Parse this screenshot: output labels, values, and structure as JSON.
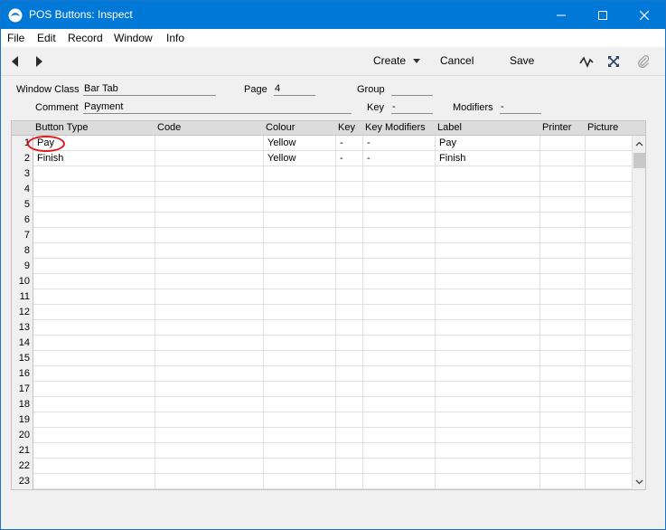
{
  "window": {
    "title": "POS Buttons: Inspect",
    "accent": "#0078d7"
  },
  "menu": [
    "File",
    "Edit",
    "Record",
    "Window",
    "Info"
  ],
  "toolbar": {
    "create_label": "Create",
    "cancel_label": "Cancel",
    "save_label": "Save"
  },
  "header": {
    "window_class_label": "Window Class",
    "window_class_value": "Bar Tab",
    "page_label": "Page",
    "page_value": "4",
    "group_label": "Group",
    "group_value": "",
    "comment_label": "Comment",
    "comment_value": "Payment",
    "key_label": "Key",
    "key_value": "-",
    "modifiers_label": "Modifiers",
    "modifiers_value": "-"
  },
  "grid": {
    "columns": [
      "Button Type",
      "Code",
      "Colour",
      "Key",
      "Key Modifiers",
      "Label",
      "Printer",
      "Picture"
    ],
    "rows": [
      {
        "num": "1",
        "cells": [
          "Pay",
          "",
          "Yellow",
          "-",
          "-",
          "Pay",
          "",
          ""
        ]
      },
      {
        "num": "2",
        "cells": [
          "Finish",
          "",
          "Yellow",
          "-",
          "-",
          "Finish",
          "",
          ""
        ]
      },
      {
        "num": "3",
        "cells": [
          "",
          "",
          "",
          "",
          "",
          "",
          "",
          ""
        ]
      },
      {
        "num": "4",
        "cells": [
          "",
          "",
          "",
          "",
          "",
          "",
          "",
          ""
        ]
      },
      {
        "num": "5",
        "cells": [
          "",
          "",
          "",
          "",
          "",
          "",
          "",
          ""
        ]
      },
      {
        "num": "6",
        "cells": [
          "",
          "",
          "",
          "",
          "",
          "",
          "",
          ""
        ]
      },
      {
        "num": "7",
        "cells": [
          "",
          "",
          "",
          "",
          "",
          "",
          "",
          ""
        ]
      },
      {
        "num": "8",
        "cells": [
          "",
          "",
          "",
          "",
          "",
          "",
          "",
          ""
        ]
      },
      {
        "num": "9",
        "cells": [
          "",
          "",
          "",
          "",
          "",
          "",
          "",
          ""
        ]
      },
      {
        "num": "10",
        "cells": [
          "",
          "",
          "",
          "",
          "",
          "",
          "",
          ""
        ]
      },
      {
        "num": "11",
        "cells": [
          "",
          "",
          "",
          "",
          "",
          "",
          "",
          ""
        ]
      },
      {
        "num": "12",
        "cells": [
          "",
          "",
          "",
          "",
          "",
          "",
          "",
          ""
        ]
      },
      {
        "num": "13",
        "cells": [
          "",
          "",
          "",
          "",
          "",
          "",
          "",
          ""
        ]
      },
      {
        "num": "14",
        "cells": [
          "",
          "",
          "",
          "",
          "",
          "",
          "",
          ""
        ]
      },
      {
        "num": "15",
        "cells": [
          "",
          "",
          "",
          "",
          "",
          "",
          "",
          ""
        ]
      },
      {
        "num": "16",
        "cells": [
          "",
          "",
          "",
          "",
          "",
          "",
          "",
          ""
        ]
      },
      {
        "num": "17",
        "cells": [
          "",
          "",
          "",
          "",
          "",
          "",
          "",
          ""
        ]
      },
      {
        "num": "18",
        "cells": [
          "",
          "",
          "",
          "",
          "",
          "",
          "",
          ""
        ]
      },
      {
        "num": "19",
        "cells": [
          "",
          "",
          "",
          "",
          "",
          "",
          "",
          ""
        ]
      },
      {
        "num": "20",
        "cells": [
          "",
          "",
          "",
          "",
          "",
          "",
          "",
          ""
        ]
      },
      {
        "num": "21",
        "cells": [
          "",
          "",
          "",
          "",
          "",
          "",
          "",
          ""
        ]
      },
      {
        "num": "22",
        "cells": [
          "",
          "",
          "",
          "",
          "",
          "",
          "",
          ""
        ]
      },
      {
        "num": "23",
        "cells": [
          "",
          "",
          "",
          "",
          "",
          "",
          "",
          ""
        ]
      }
    ]
  },
  "annotation": {
    "color": "#e41b1b"
  }
}
